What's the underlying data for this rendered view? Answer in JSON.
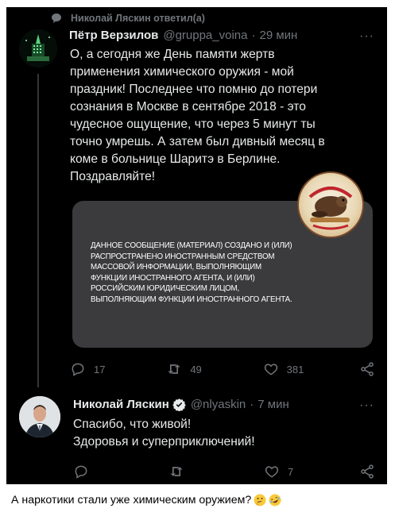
{
  "retweet": {
    "text": "Николай Ляскин ответил(а)"
  },
  "tweet1": {
    "name": "Пётр Верзилов",
    "handle": "@gruppa_voina",
    "time": "29 мин",
    "text": "О, а сегодня же День памяти жертв\nприменения химического оружия - мой\nпраздник! Последнее что помню до потери\nсознания в Москве в сентябре 2018 - это\nчудесное ощущение, что через 5 минут ты\nточно умрешь. А затем был дивный месяц в\nкоме в больнице Шаритэ в Берлине.\nПоздравляйте!",
    "media_notice": "ДАННОЕ СООБЩЕНИЕ (МАТЕРИАЛ) СОЗДАНО И (ИЛИ)\nРАСПРОСТРАНЕНО ИНОСТРАННЫМ СРЕДСТВОМ\nМАССОВОЙ ИНФОРМАЦИИ, ВЫПОЛНЯЮЩИМ\nФУНКЦИИ ИНОСТРАННОГО АГЕНТА, И (ИЛИ)\nРОССИЙСКИМ ЮРИДИЧЕСКИМ ЛИЦОМ,\nВЫПОЛНЯЮЩИМ ФУНКЦИИ ИНОСТРАННОГО АГЕНТА.",
    "replies": "17",
    "retweets": "49",
    "likes": "381"
  },
  "tweet2": {
    "name": "Николай Ляскин",
    "handle": "@nlyaskin",
    "time": "7 мин",
    "text": "Спасибо, что живой!\nЗдоровья и суперприключений!",
    "replies": "",
    "retweets": "",
    "likes": "7"
  },
  "separator": "·",
  "more": "···",
  "caption": {
    "text": "А наркотики стали уже химическим оружием?"
  },
  "icons": {
    "retweet_small": "retweet-icon",
    "reply": "reply-icon",
    "retweet": "retweet-icon",
    "like": "heart-icon",
    "share": "share-icon",
    "verified": "verified-badge-icon",
    "emoji1": "thinking-face-icon",
    "emoji2": "rofl-face-icon"
  },
  "colors": {
    "background": "#000000",
    "text": "#e7e9ea",
    "muted": "#71767b",
    "media_bg": "#3b3b3d",
    "verified": "#e7e9ea"
  }
}
